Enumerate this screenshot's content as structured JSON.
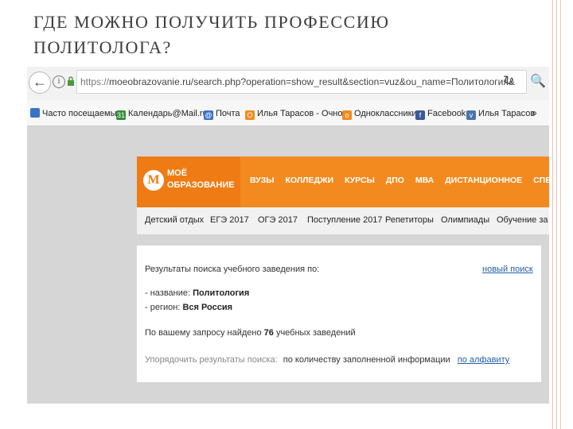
{
  "slide": {
    "title": "ГДЕ МОЖНО ПОЛУЧИТЬ ПРОФЕССИЮ ПОЛИТОЛОГА?"
  },
  "browser": {
    "url_prefix": "https://",
    "url_rest": "moeobrazovanie.ru/search.php?operation=show_result&section=vuz&ou_name=Политология&",
    "back_icon": "arrow-left-icon",
    "info_icon": "info-icon",
    "lock_icon": "lock-icon",
    "reload_icon": "reload-icon",
    "search_icon": "search-icon",
    "bookmarks": [
      {
        "label": "Часто посещаемые",
        "icon": "page-icon",
        "color": "#3b73c4"
      },
      {
        "label": "Календарь@Mail.ru",
        "icon": "calendar-icon",
        "color": "#2f8f3a"
      },
      {
        "label": "Почта",
        "icon": "mail-icon",
        "color": "#3b73c4"
      },
      {
        "label": "Илья Тарасов - Очно...",
        "icon": "odnoklassniki-icon",
        "color": "#f28a1f"
      },
      {
        "label": "Одноклассники",
        "icon": "odnoklassniki-icon",
        "color": "#f28a1f"
      },
      {
        "label": "Facebook",
        "icon": "facebook-icon",
        "color": "#3b5998"
      },
      {
        "label": "Илья Тарасов",
        "icon": "vk-icon",
        "color": "#4a76a8"
      }
    ],
    "more_label": "»"
  },
  "site": {
    "logo_line1": "МОЁ",
    "logo_line2": "ОБРАЗОВАНИЕ",
    "main_nav": [
      "ВУЗЫ",
      "КОЛЛЕДЖИ",
      "КУРСЫ",
      "ДПО",
      "МВА",
      "ДИСТАНЦИОННОЕ",
      "СПЕЦИАЛЬНО"
    ],
    "sub_nav": [
      "Детский отдых",
      "ЕГЭ 2017",
      "ОГЭ 2017",
      "Поступление 2017",
      "Репетиторы",
      "Олимпиады",
      "Обучение за р"
    ],
    "accent": "#f28a1f",
    "accent_dark": "#ef7b14"
  },
  "results": {
    "heading": "Результаты поиска учебного заведения по:",
    "new_search": "новый поиск",
    "name_label": "- название:",
    "name_value": "Политология",
    "region_label": "- регион:",
    "region_value": "Вся Россия",
    "found_prefix": "По вашему запросу найдено",
    "found_count": "76",
    "found_suffix": "учебных заведений",
    "sort_label": "Упорядочить результаты поиска:",
    "sort_current": "по количеству заполненной информации",
    "sort_alpha": "по алфавиту"
  }
}
